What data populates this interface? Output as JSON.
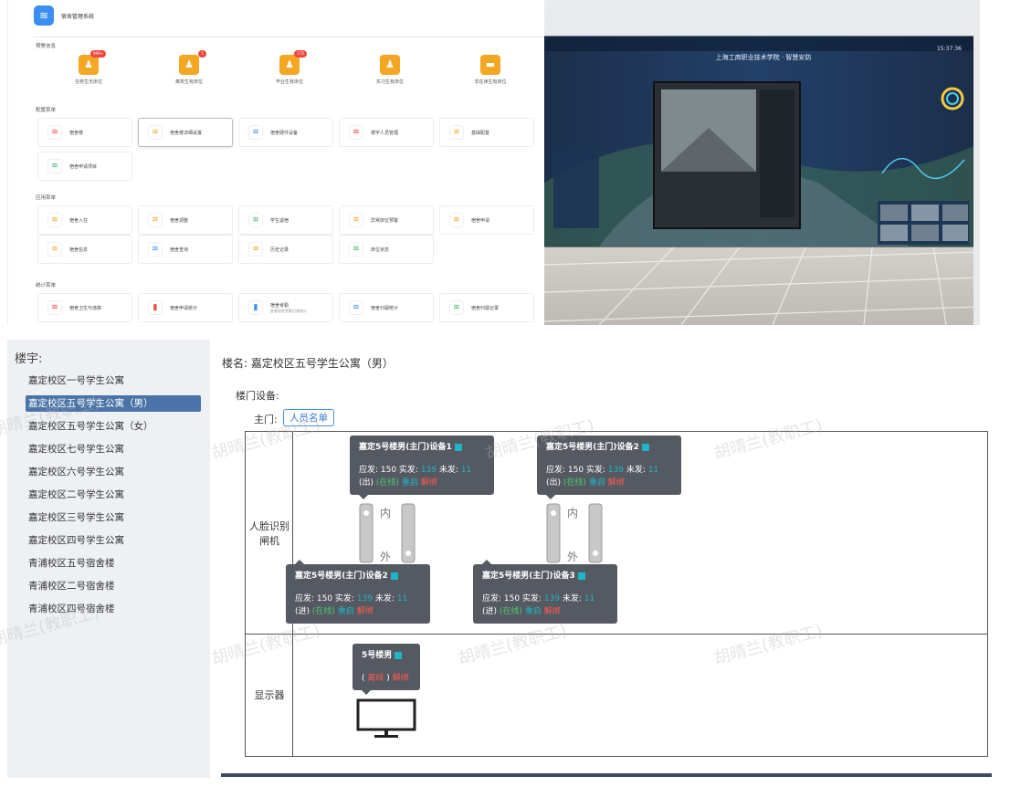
{
  "dashboard": {
    "app_title": "宿舍管理系统",
    "alert_section": "预警信息",
    "alerts": [
      {
        "label": "在校生无床位",
        "badge": "999+"
      },
      {
        "label": "离校生有床位",
        "badge": "1"
      },
      {
        "label": "毕业生有床位",
        "badge": "175"
      },
      {
        "label": "实习生有床位",
        "badge": ""
      },
      {
        "label": "非在读生有床位",
        "badge": ""
      }
    ],
    "config_section": "配置菜单",
    "config_items": [
      "宿舍楼",
      "宿舍楼详细设置",
      "宿舍硬件设备",
      "楼宇人员管理",
      "基础配置",
      "宿舍申请项目"
    ],
    "app_section": "应用菜单",
    "app_items": [
      "宿舍入住",
      "宿舍调整",
      "学生退宿",
      "异常床位预警",
      "宿舍申请",
      "宿舍信息",
      "宿舍查询",
      "历史记录",
      "床位状态"
    ],
    "stats_section": "统计菜单",
    "stats_items": [
      "宿舍卫生与违章",
      "宿舍申请统计",
      "宿舍考勤",
      "宿舍归寝统计",
      "宿舍归寝记录"
    ],
    "stats_sub": "查看宿舍考勤归寝统计"
  },
  "photo": {
    "screen_title": "上海工商职业技术学院 · 智慧安防",
    "clock": "15:37:36"
  },
  "sidebar": {
    "title": "楼宇:",
    "items": [
      "嘉定校区一号学生公寓",
      "嘉定校区五号学生公寓（男）",
      "嘉定校区五号学生公寓（女）",
      "嘉定校区七号学生公寓",
      "嘉定校区六号学生公寓",
      "嘉定校区二号学生公寓",
      "嘉定校区三号学生公寓",
      "嘉定校区四号学生公寓",
      "青浦校区五号宿舍楼",
      "青浦校区二号宿舍楼",
      "青浦校区四号宿舍楼"
    ],
    "active_index": 1
  },
  "main": {
    "building_name": "楼名: 嘉定校区五号学生公寓（男）",
    "door_devices_label": "楼门设备:",
    "main_door_label": "主门:",
    "roster_button": "人员名单",
    "row1_label": "人脸识别闸机",
    "row2_label": "显示器",
    "gate_in": "内",
    "gate_out": "外",
    "devices": [
      {
        "name": "嘉定5号楼男(主门)设备1",
        "issued": "应发: 150 实发:",
        "actual": "139",
        "pending_label": "未发:",
        "pending": "11",
        "dir": "(出)",
        "status": "(在线)",
        "restart": "重启",
        "unbind": "解绑"
      },
      {
        "name": "嘉定5号楼男(主门)设备2",
        "issued": "应发: 150 实发:",
        "actual": "139",
        "pending_label": "未发:",
        "pending": "11",
        "dir": "(出)",
        "status": "(在线)",
        "restart": "重启",
        "unbind": "解绑"
      },
      {
        "name": "嘉定5号楼男(主门)设备2",
        "issued": "应发: 150 实发:",
        "actual": "139",
        "pending_label": "未发:",
        "pending": "11",
        "dir": "(进)",
        "status": "(在线)",
        "restart": "重启",
        "unbind": "解绑"
      },
      {
        "name": "嘉定5号楼男(主门)设备3",
        "issued": "应发: 150 实发:",
        "actual": "139",
        "pending_label": "未发:",
        "pending": "11",
        "dir": "(进)",
        "status": "(在线)",
        "restart": "重启",
        "unbind": "解绑"
      }
    ],
    "display": {
      "name": "5号楼男",
      "status": "离线",
      "unbind": "解绑"
    }
  },
  "watermark": "胡晴兰(教职工)",
  "colors": {
    "accent": "#4a73a8",
    "cyan": "#1fb5c9",
    "green": "#4ccb6e",
    "red": "#ff5a4d",
    "bubble": "#555962"
  }
}
